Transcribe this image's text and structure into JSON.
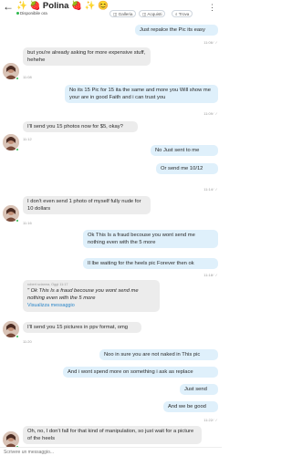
{
  "header": {
    "back_icon": "back-arrow-icon",
    "title": "✨ 🍓 Polina 🍓 ✨ 😊",
    "status": "Disponibile ora",
    "tabs": [
      "Galleria",
      "Acquisti",
      "Trova"
    ]
  },
  "messages": [
    {
      "side": "out",
      "text": "Just repalce the Pic its easy",
      "time": "11:06"
    },
    {
      "side": "in",
      "text": "but you're already asking for more expensive stuff, hehehe",
      "time": "11:08"
    },
    {
      "side": "out",
      "text": "No its 15 Pic for 15 ita the same and more you Will show me your are in good Faith and i can trust you",
      "time": "11:09"
    },
    {
      "side": "in",
      "text": "I'll send you 15 photos now for $5, okay?",
      "time": "11:12"
    },
    {
      "side": "out",
      "text": "No Just sent to me",
      "time": ""
    },
    {
      "side": "out",
      "text": "Or send me 10/12",
      "time": "11:14"
    },
    {
      "side": "in",
      "text": "I don't even send 1 photo of myself fully nude for 10 dollars",
      "time": "11:16"
    },
    {
      "side": "out",
      "text": "Ok This Is a fraud becouse you wont send me nothing even with the 5 more",
      "time": ""
    },
    {
      "side": "out",
      "text": "Il lbe waiting for the heels pic Forever then ok",
      "time": "11:18"
    },
    {
      "side": "in",
      "quote_meta": "robert scianna, Oggi 11:17",
      "quote": "\" Ok This Is a fraud becouse you wont send me nothing even with the 5 more",
      "quote_link": "Visualizza messaggio",
      "time": ""
    },
    {
      "side": "in",
      "text": "I'll send you 15 pictures in ppv format, omg",
      "time": "11:20"
    },
    {
      "side": "out",
      "text": "Noo in sure you are not naked in This pic",
      "time": ""
    },
    {
      "side": "out",
      "text": "And i wont spend more on something i ask as replace",
      "time": ""
    },
    {
      "side": "out",
      "text": "Just send",
      "time": ""
    },
    {
      "side": "out",
      "text": "And we be good",
      "time": "11:22"
    },
    {
      "side": "in",
      "text": "Oh, no, I don't fall for that kind of manipulation, so just wait for a picture of the heels",
      "time": ""
    }
  ],
  "input": {
    "placeholder": "Scrivere un messaggio..."
  },
  "colors": {
    "outgoing": "#dff0fb",
    "incoming": "#ececec",
    "online": "#2db84d",
    "link": "#2a86c9"
  }
}
